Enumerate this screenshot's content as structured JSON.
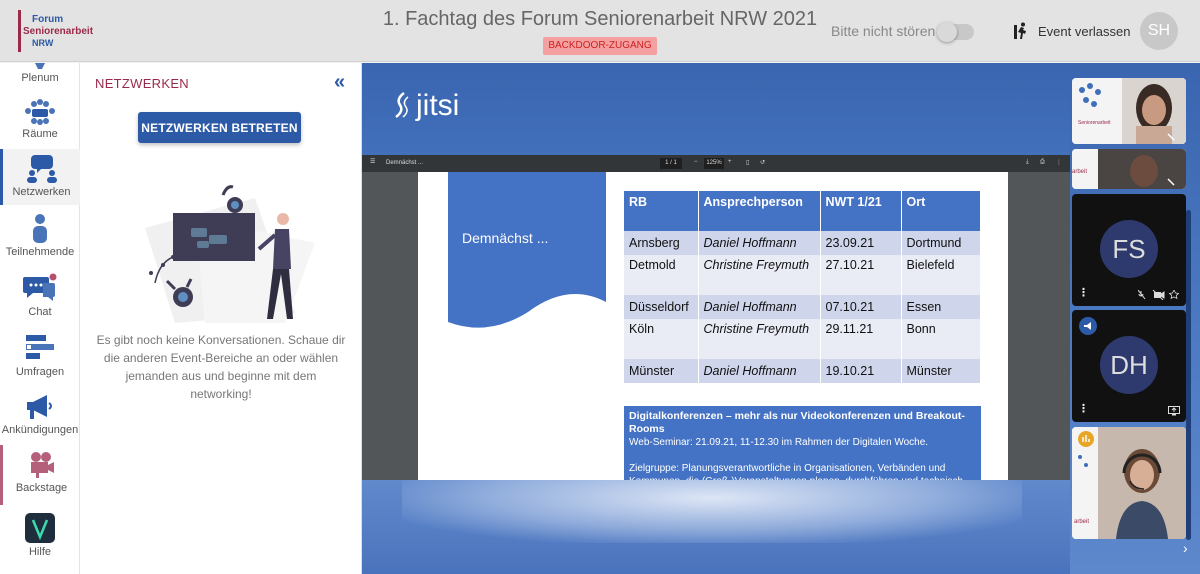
{
  "header": {
    "logo": {
      "line1": "Forum",
      "line2": "Seniorenarbeit",
      "line3": "NRW"
    },
    "event_title": "1. Fachtag des Forum Seniorenarbeit NRW 2021",
    "backdoor_badge": "BACKDOOR-ZUGANG",
    "dnd_label": "Bitte nicht stören",
    "leave_label": "Event verlassen",
    "user_initials": "SH"
  },
  "sidebar": {
    "items": [
      {
        "label": "Plenum"
      },
      {
        "label": "Räume"
      },
      {
        "label": "Netzwerken"
      },
      {
        "label": "Teilnehmende"
      },
      {
        "label": "Chat"
      },
      {
        "label": "Umfragen"
      },
      {
        "label": "Ankündigungen"
      },
      {
        "label": "Backstage"
      },
      {
        "label": "Hilfe"
      }
    ]
  },
  "panel": {
    "title": "NETZWERKEN",
    "collapse_icon": "«",
    "join_button": "NETZWERKEN BETRETEN",
    "empty_text": "Es gibt noch keine Konversationen. Schaue dir die anderen Event-Bereiche an oder wählen jemanden aus und beginne mit dem networking!"
  },
  "stage": {
    "brand": "jitsi",
    "pdf": {
      "doc_name": "Demnächst ...",
      "page": "1 / 1",
      "zoom": "125%"
    },
    "slide": {
      "banner_text": "Demnächst ...",
      "table": {
        "headers": [
          "RB",
          "Ansprechperson",
          "NWT 1/21",
          "Ort"
        ],
        "rows": [
          [
            "Arnsberg",
            "Daniel Hoffmann",
            "23.09.21",
            "Dortmund"
          ],
          [
            "Detmold",
            "Christine Freymuth",
            "27.10.21",
            "Bielefeld"
          ],
          [
            "Düsseldorf",
            "Daniel Hoffmann",
            "07.10.21",
            "Essen"
          ],
          [
            "Köln",
            "Christine Freymuth",
            "29.11.21",
            "Bonn"
          ],
          [
            "Münster",
            "Daniel Hoffmann",
            "19.10.21",
            "Münster"
          ]
        ]
      },
      "info_title": "Digitalkonferenzen – mehr als nur Videokonferenzen und Breakout-Rooms",
      "info_line1": "Web-Seminar: 21.09.21, 11-12.30 im Rahmen der Digitalen Woche.",
      "info_line2": "Zielgruppe: Planungsverantwortliche in Organisationen, Verbänden und Kommunen, die (Groß-)Veranstaltungen planen, durchführen und technisch"
    }
  },
  "participants": [
    {
      "initials": "FS"
    },
    {
      "initials": "DH"
    }
  ],
  "colors": {
    "brand_blue": "#2d5aa6",
    "brand_red": "#9b2a4a",
    "slide_blue": "#4472c4"
  }
}
